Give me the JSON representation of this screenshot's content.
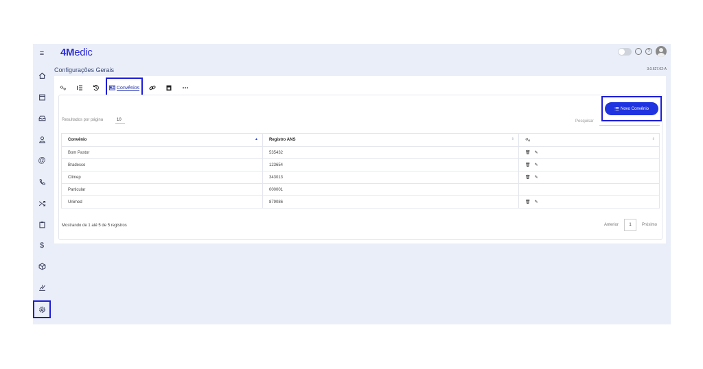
{
  "app": {
    "logo_bold": "4M",
    "logo_rest": "edic",
    "page_title": "Configurações Gerais",
    "version": "3.0.627.02-A"
  },
  "sidebar": {
    "items": [
      {
        "name": "menu-icon",
        "glyph": "≡"
      },
      {
        "name": "home-icon",
        "glyph": "⌂"
      },
      {
        "name": "calendar-icon",
        "glyph": "▭"
      },
      {
        "name": "inbox-icon",
        "glyph": "⊟"
      },
      {
        "name": "user-icon",
        "glyph": "♙"
      },
      {
        "name": "at-icon",
        "glyph": "@"
      },
      {
        "name": "phone-icon",
        "glyph": "✆"
      },
      {
        "name": "shuffle-icon",
        "glyph": "⤨"
      },
      {
        "name": "clipboard-icon",
        "glyph": "▣"
      },
      {
        "name": "dollar-icon",
        "glyph": "$"
      },
      {
        "name": "box-icon",
        "glyph": "⬡"
      },
      {
        "name": "chart-icon",
        "glyph": "⌁"
      },
      {
        "name": "settings-icon",
        "glyph": "⚙"
      }
    ]
  },
  "toolbar": {
    "active_label": "Convênios"
  },
  "list": {
    "results_label": "Resultados por página",
    "results_value": "10",
    "search_label": "Pesquisar",
    "search_value": "",
    "new_button": "Novo Convênio",
    "columns": [
      "Convênio",
      "Registro ANS"
    ],
    "rows": [
      {
        "convenio": "Bom Pastor",
        "registro": "535432",
        "actions": true
      },
      {
        "convenio": "Bradesco",
        "registro": "123654",
        "actions": true
      },
      {
        "convenio": "Climep",
        "registro": "343013",
        "actions": true
      },
      {
        "convenio": "Particular",
        "registro": "000001",
        "actions": false
      },
      {
        "convenio": "Unimed",
        "registro": "879086",
        "actions": true
      }
    ],
    "footer_info": "Mostrando de 1 até 5 de 5 registros",
    "prev": "Anterior",
    "page": "1",
    "next": "Próximo"
  },
  "colors": {
    "accent": "#1f33e0",
    "highlight": "#1c1cd9",
    "background": "#eaeef8"
  }
}
